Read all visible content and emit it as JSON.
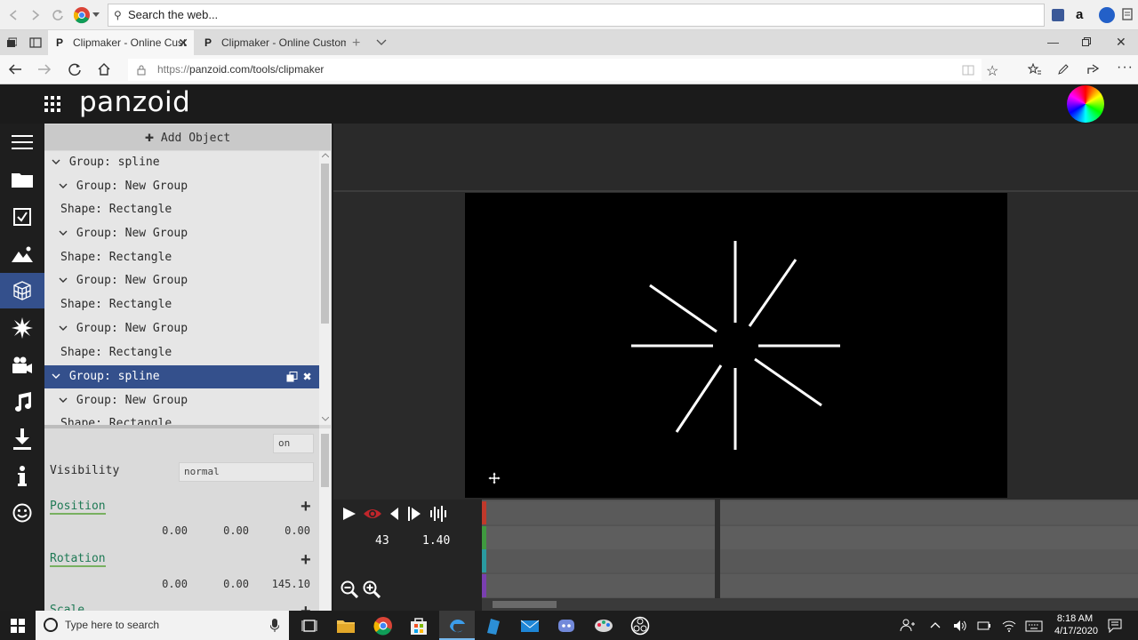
{
  "browser": {
    "search_placeholder": "Search the web...",
    "tabs": [
      {
        "label": "Clipmaker - Online Cust",
        "active": true
      },
      {
        "label": "Clipmaker - Online Custom",
        "active": false
      }
    ],
    "url_scheme": "https://",
    "url_rest": "panzoid.com/tools/clipmaker"
  },
  "app": {
    "logo": "panzoid",
    "add_object_label": "Add Object"
  },
  "tree": {
    "rows": [
      {
        "label": "Group: spline",
        "indent": 0,
        "chevron": true,
        "selected": false
      },
      {
        "label": "Group: New Group",
        "indent": 1,
        "chevron": true,
        "selected": false
      },
      {
        "label": "Shape: Rectangle",
        "indent": 2,
        "chevron": false,
        "selected": false
      },
      {
        "label": "Group: New Group",
        "indent": 1,
        "chevron": true,
        "selected": false
      },
      {
        "label": "Shape: Rectangle",
        "indent": 2,
        "chevron": false,
        "selected": false
      },
      {
        "label": "Group: New Group",
        "indent": 1,
        "chevron": true,
        "selected": false
      },
      {
        "label": "Shape: Rectangle",
        "indent": 2,
        "chevron": false,
        "selected": false
      },
      {
        "label": "Group: New Group",
        "indent": 1,
        "chevron": true,
        "selected": false
      },
      {
        "label": "Shape: Rectangle",
        "indent": 2,
        "chevron": false,
        "selected": false
      },
      {
        "label": "Group: spline",
        "indent": 0,
        "chevron": true,
        "selected": true
      },
      {
        "label": "Group: New Group",
        "indent": 1,
        "chevron": true,
        "selected": false
      },
      {
        "label": "Shape: Rectangle",
        "indent": 2,
        "chevron": false,
        "selected": false
      }
    ]
  },
  "props": {
    "toggle_value": "on",
    "visibility_label": "Visibility",
    "visibility_value": "normal",
    "position_label": "Position",
    "position_values": [
      "0.00",
      "0.00",
      "0.00"
    ],
    "rotation_label": "Rotation",
    "rotation_values": [
      "0.00",
      "0.00",
      "145.10"
    ],
    "scale_label": "Scale"
  },
  "timeline": {
    "frame": "43",
    "time": "1.40"
  },
  "taskbar": {
    "search_placeholder": "Type here to search",
    "clock_time": "8:18 AM",
    "clock_date": "4/17/2020"
  },
  "colors": {
    "selection": "#34508c",
    "lane_colors": [
      "#c0392b",
      "#3f9a3f",
      "#2a9aa0",
      "#7a3fb0"
    ]
  }
}
